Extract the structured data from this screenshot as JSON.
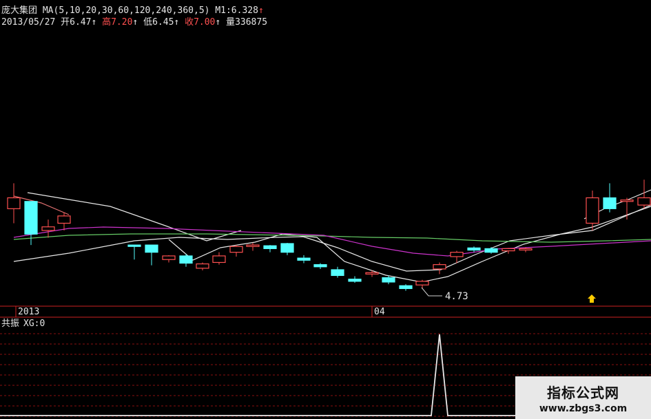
{
  "header": {
    "stock_name": "庞大集团",
    "ma_label": "MA(5,10,20,30,60,120,240,360,5)",
    "m1_label": "M1:6.328",
    "m1_arrow": "↑",
    "date": "2013/05/27",
    "open_label": "开",
    "open_value": "6.47",
    "open_arrow": "↑",
    "high_label": "高",
    "high_value": "7.20",
    "high_arrow": "↑",
    "low_label": "低",
    "low_value": "6.45",
    "low_arrow": "↑",
    "close_label": "收",
    "close_value": "7.00",
    "close_arrow": "↑",
    "volume_label": "量",
    "volume_value": "336875"
  },
  "axis": {
    "year_label": "2013",
    "month_label": "04"
  },
  "price_annotation": "4.73",
  "indicator": {
    "title": "共振",
    "value_label": "XG:0"
  },
  "watermark": {
    "title": "指标公式网",
    "url": "www.zbgs3.com"
  },
  "colors": {
    "up": "#ff5050",
    "down": "#55ffff",
    "ma_white": "#e8e8e8",
    "ma_green": "#66cc66",
    "ma_purple": "#cc33cc",
    "grid": "#8a1010"
  },
  "chart_data": {
    "type": "candlestick",
    "candles": [
      {
        "o": 5.4,
        "h": 5.75,
        "l": 5.2,
        "c": 5.55
      },
      {
        "o": 5.5,
        "h": 5.5,
        "l": 4.9,
        "c": 5.05
      },
      {
        "o": 5.1,
        "h": 5.25,
        "l": 5.0,
        "c": 5.15
      },
      {
        "o": 5.2,
        "h": 5.35,
        "l": 5.1,
        "c": 5.3
      },
      {
        "o": 4.9,
        "h": 4.9,
        "l": 4.7,
        "c": 4.88
      },
      {
        "o": 4.9,
        "h": 4.9,
        "l": 4.62,
        "c": 4.8
      },
      {
        "o": 4.7,
        "h": 4.76,
        "l": 4.66,
        "c": 4.75
      },
      {
        "o": 4.75,
        "h": 4.78,
        "l": 4.6,
        "c": 4.65
      },
      {
        "o": 4.58,
        "h": 4.66,
        "l": 4.55,
        "c": 4.64
      },
      {
        "o": 4.66,
        "h": 4.8,
        "l": 4.63,
        "c": 4.75
      },
      {
        "o": 4.8,
        "h": 4.9,
        "l": 4.74,
        "c": 4.88
      },
      {
        "o": 4.88,
        "h": 4.93,
        "l": 4.82,
        "c": 4.9
      },
      {
        "o": 4.89,
        "h": 4.9,
        "l": 4.8,
        "c": 4.85
      },
      {
        "o": 4.92,
        "h": 4.93,
        "l": 4.76,
        "c": 4.8
      },
      {
        "o": 4.72,
        "h": 4.76,
        "l": 4.65,
        "c": 4.69
      },
      {
        "o": 4.63,
        "h": 4.65,
        "l": 4.57,
        "c": 4.6
      },
      {
        "o": 4.56,
        "h": 4.6,
        "l": 4.45,
        "c": 4.48
      },
      {
        "o": 4.43,
        "h": 4.47,
        "l": 4.38,
        "c": 4.4
      },
      {
        "o": 4.5,
        "h": 4.55,
        "l": 4.46,
        "c": 4.52
      },
      {
        "o": 4.45,
        "h": 4.48,
        "l": 4.36,
        "c": 4.39
      },
      {
        "o": 4.34,
        "h": 4.36,
        "l": 4.27,
        "c": 4.3
      },
      {
        "o": 4.35,
        "h": 4.42,
        "l": 4.3,
        "c": 4.4
      },
      {
        "o": 4.57,
        "h": 4.66,
        "l": 4.5,
        "c": 4.63
      },
      {
        "o": 4.74,
        "h": 4.82,
        "l": 4.65,
        "c": 4.8
      },
      {
        "o": 4.86,
        "h": 4.88,
        "l": 4.8,
        "c": 4.83
      },
      {
        "o": 4.85,
        "h": 4.87,
        "l": 4.78,
        "c": 4.8
      },
      {
        "o": 4.82,
        "h": 4.86,
        "l": 4.78,
        "c": 4.85
      },
      {
        "o": 4.84,
        "h": 4.87,
        "l": 4.8,
        "c": 4.85
      },
      {
        "o": 5.2,
        "h": 5.65,
        "l": 5.1,
        "c": 5.55
      },
      {
        "o": 5.55,
        "h": 5.75,
        "l": 5.35,
        "c": 5.4
      },
      {
        "o": 5.5,
        "h": 5.55,
        "l": 5.25,
        "c": 5.52
      },
      {
        "o": 5.45,
        "h": 5.8,
        "l": 5.4,
        "c": 5.55
      }
    ],
    "indicator_values": [
      0,
      0,
      0,
      0,
      0,
      0,
      0,
      0,
      0,
      0,
      0,
      0,
      0,
      0,
      0,
      0,
      0,
      0,
      0,
      0,
      0,
      0,
      0,
      1,
      0,
      0,
      0,
      0,
      0,
      0,
      0,
      0
    ],
    "low_marker": 4.73
  }
}
